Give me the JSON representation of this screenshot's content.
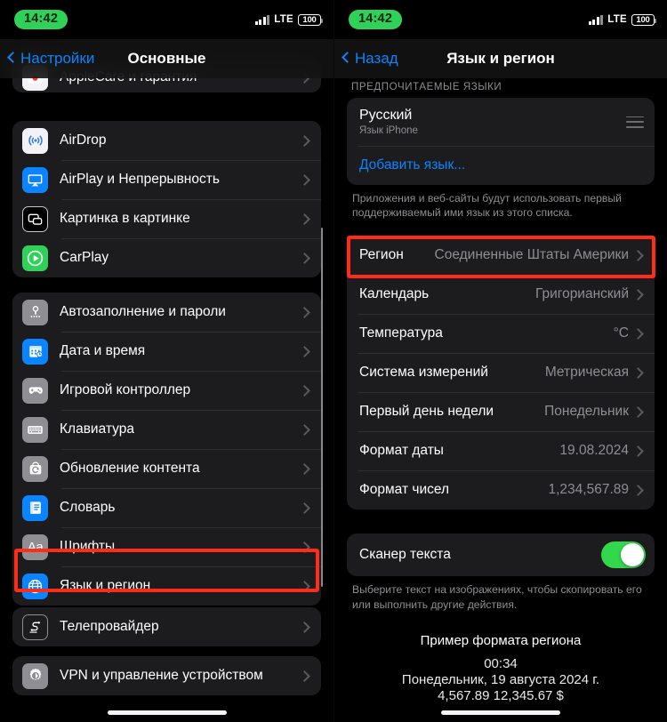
{
  "colors": {
    "bg": "#000000",
    "group": "#1c1c1e",
    "accent_blue": "#0a84ff",
    "green": "#32d74b",
    "highlight_red": "#ff2d17",
    "secondary_text": "#8e8e93"
  },
  "left": {
    "status": {
      "time": "14:42",
      "network": "LTE",
      "battery": "100"
    },
    "nav": {
      "back_label": "Настройки",
      "title": "Основные"
    },
    "clipped_row": {
      "label": "AppleCare и гарантия",
      "icon": "applecare-icon"
    },
    "group1": [
      {
        "label": "AirDrop",
        "icon": "airdrop-icon",
        "icon_bg": "#f2f2f7"
      },
      {
        "label": "AirPlay и Непрерывность",
        "icon": "airplay-icon",
        "icon_bg": "#0a84ff"
      },
      {
        "label": "Картинка в картинке",
        "icon": "picture-in-picture-icon",
        "icon_bg": "#000000"
      },
      {
        "label": "CarPlay",
        "icon": "carplay-icon",
        "icon_bg": "#30d158"
      }
    ],
    "group2": [
      {
        "label": "Автозаполнение и пароли",
        "icon": "key-icon",
        "icon_bg": "#8e8e93"
      },
      {
        "label": "Дата и время",
        "icon": "calendar-clock-icon",
        "icon_bg": "#0a84ff"
      },
      {
        "label": "Игровой контроллер",
        "icon": "gamepad-icon",
        "icon_bg": "#8e8e93"
      },
      {
        "label": "Клавиатура",
        "icon": "keyboard-icon",
        "icon_bg": "#8e8e93"
      },
      {
        "label": "Обновление контента",
        "icon": "content-refresh-icon",
        "icon_bg": "#8e8e93"
      },
      {
        "label": "Словарь",
        "icon": "dictionary-book-icon",
        "icon_bg": "#0a84ff"
      },
      {
        "label": "Шрифты",
        "icon": "fonts-aa-icon",
        "icon_bg": "#8e8e93"
      },
      {
        "label": "Язык и регион",
        "icon": "globe-icon",
        "icon_bg": "#0a84ff",
        "highlighted": true
      }
    ],
    "group3": [
      {
        "label": "Телепровайдер",
        "icon": "tv-provider-icon",
        "icon_bg": "#1c1c1e"
      }
    ],
    "group4": [
      {
        "label": "VPN и управление устройством",
        "icon": "vpn-gear-icon",
        "icon_bg": "#8e8e93"
      }
    ]
  },
  "right": {
    "status": {
      "time": "14:42",
      "network": "LTE",
      "battery": "100"
    },
    "nav": {
      "back_label": "Назад",
      "title": "Язык и регион"
    },
    "languages": {
      "header": "ПРЕДПОЧИТАЕМЫЕ ЯЗЫКИ",
      "primary": {
        "name": "Русский",
        "subtitle": "Язык iPhone",
        "handle_icon": "reorder-handle-icon"
      },
      "add_label": "Добавить язык...",
      "footnote": "Приложения и веб-сайты будут использовать первый поддерживаемый ими язык из этого списка."
    },
    "settings": [
      {
        "label": "Регион",
        "value": "Соединенные Штаты Америки",
        "highlighted": true
      },
      {
        "label": "Календарь",
        "value": "Григорианский"
      },
      {
        "label": "Температура",
        "value": "°C"
      },
      {
        "label": "Система измерений",
        "value": "Метрическая"
      },
      {
        "label": "Первый день недели",
        "value": "Понедельник"
      },
      {
        "label": "Формат даты",
        "value": "19.08.2024"
      },
      {
        "label": "Формат чисел",
        "value": "1,234,567.89"
      }
    ],
    "scanner": {
      "label": "Сканер текста",
      "enabled": true,
      "footnote": "Выберите текст на изображениях, чтобы скопировать его или выполнить другие действия."
    },
    "example": {
      "title": "Пример формата региона",
      "time": "00:34",
      "date": "Понедельник, 19 августа 2024 г.",
      "numbers": "4,567.89 12,345.67 $"
    }
  }
}
